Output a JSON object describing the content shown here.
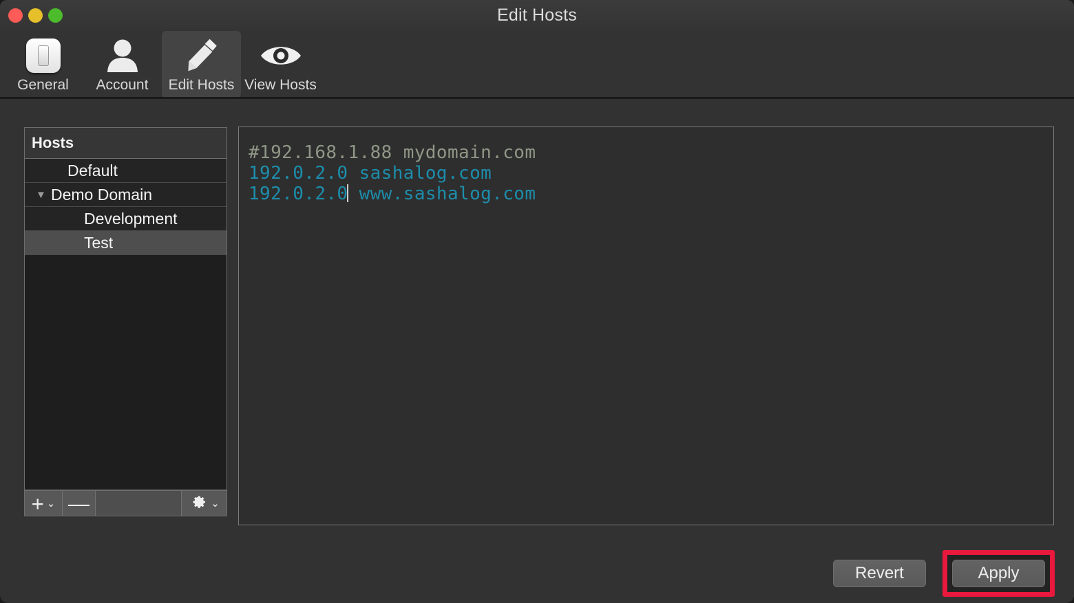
{
  "window": {
    "title": "Edit Hosts",
    "traffic_lights": [
      {
        "name": "close",
        "color": "#fc5b57"
      },
      {
        "name": "minimize",
        "color": "#e6c02b"
      },
      {
        "name": "maximize",
        "color": "#4cbb2c"
      }
    ]
  },
  "toolbar": {
    "items": [
      {
        "label": "General",
        "icon": "light-switch-icon",
        "selected": false
      },
      {
        "label": "Account",
        "icon": "person-icon",
        "selected": false
      },
      {
        "label": "Edit Hosts",
        "icon": "pencil-icon",
        "selected": true
      },
      {
        "label": "View Hosts",
        "icon": "eye-icon",
        "selected": false
      }
    ]
  },
  "sidebar": {
    "header": "Hosts",
    "rows": [
      {
        "label": "Default",
        "indent": 1,
        "selected": false,
        "disclosure": ""
      },
      {
        "label": "Demo Domain",
        "indent": 0,
        "selected": false,
        "disclosure": "▼"
      },
      {
        "label": "Development",
        "indent": 2,
        "selected": false,
        "disclosure": ""
      },
      {
        "label": "Test",
        "indent": 2,
        "selected": true,
        "disclosure": ""
      }
    ],
    "footer": {
      "add_label": "+",
      "add_chevron": "⌄",
      "remove_label": "—",
      "gear_chevron": "⌄"
    }
  },
  "editor": {
    "lines": [
      {
        "ip": "#192.168.1.88",
        "host": "mydomain.com",
        "type": "comment",
        "caret_after_ip": false
      },
      {
        "ip": "192.0.2.0",
        "host": "sashalog.com",
        "type": "entry",
        "caret_after_ip": false
      },
      {
        "ip": "192.0.2.0",
        "host": "www.sashalog.com",
        "type": "entry",
        "caret_after_ip": true
      }
    ]
  },
  "actions": {
    "revert_label": "Revert",
    "apply_label": "Apply",
    "apply_highlight_color": "#e8193c"
  }
}
